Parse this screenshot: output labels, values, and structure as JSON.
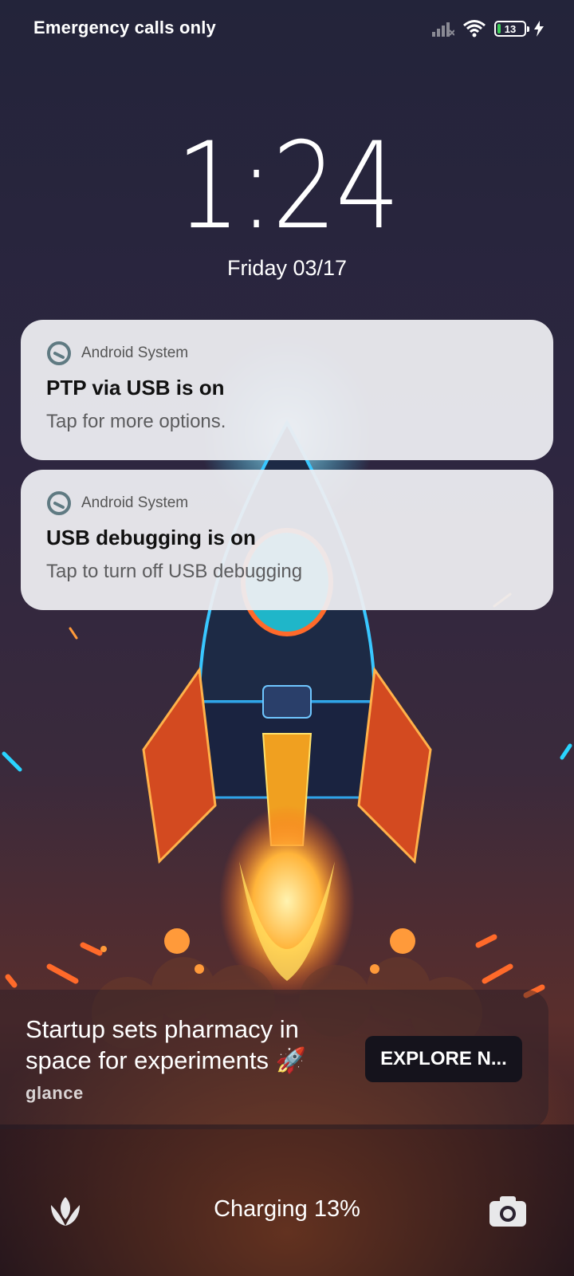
{
  "status_bar": {
    "carrier_text": "Emergency calls only",
    "battery_level": "13",
    "battery_fraction": 0.13,
    "icons": [
      "signal-no-service-icon",
      "wifi-icon",
      "battery-icon",
      "charging-bolt-icon"
    ]
  },
  "lock": {
    "time": "1:24",
    "date": "Friday 03/17"
  },
  "notifications": [
    {
      "app": "Android System",
      "title": "PTP via USB is on",
      "body": "Tap for more options."
    },
    {
      "app": "Android System",
      "title": "USB debugging is on",
      "body": "Tap to turn off USB debugging"
    }
  ],
  "glance": {
    "headline": "Startup sets pharmacy in space for experiments 🚀",
    "button_label": "EXPLORE N...",
    "brand": "glance"
  },
  "bottom": {
    "charging_text": "Charging 13%",
    "left_icon": "flower-icon",
    "right_icon": "camera-icon"
  },
  "colors": {
    "battery_fill": "#3fd15a",
    "notification_bg": "#eeeef2",
    "button_bg": "#15131c"
  }
}
